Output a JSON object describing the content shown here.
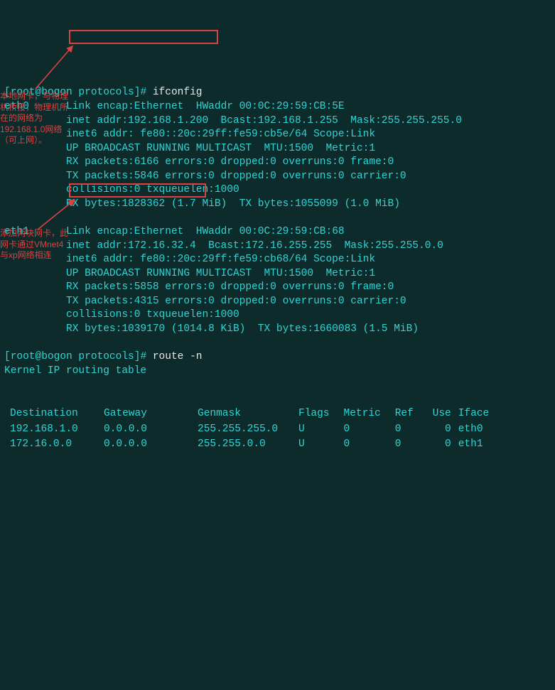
{
  "prompt1": {
    "user_host": "root@bogon",
    "dir": "protocols",
    "cmd": "ifconfig"
  },
  "prompt2": {
    "user_host": "root@bogon",
    "dir": "protocols",
    "cmd": "route -n"
  },
  "eth0": {
    "name": "eth0",
    "link": "Link encap:Ethernet  HWaddr 00:0C:29:59:CB:5E",
    "inet": "inet addr:192.168.1.200",
    "inet_rest": "  Bcast:192.168.1.255  Mask:255.255.255.0",
    "inet6": "inet6 addr: fe80::20c:29ff:fe59:cb5e/64 Scope:Link",
    "flags": "UP BROADCAST RUNNING MULTICAST  MTU:1500  Metric:1",
    "rx": "RX packets:6166 errors:0 dropped:0 overruns:0 frame:0",
    "tx": "TX packets:5846 errors:0 dropped:0 overruns:0 carrier:0",
    "coll": "collisions:0 txqueuelen:1000",
    "bytes": "RX bytes:1828362 (1.7 MiB)  TX bytes:1055099 (1.0 MiB)"
  },
  "eth1": {
    "name": "eth1",
    "link": "Link encap:Ethernet  HWaddr 00:0C:29:59:CB:68",
    "inet": "inet addr:172.16.32.4",
    "inet_rest": "  Bcast:172.16.255.255  Mask:255.255.0.0",
    "inet6": "inet6 addr: fe80::20c:29ff:fe59:cb68/64 Scope:Link",
    "flags": "UP BROADCAST RUNNING MULTICAST  MTU:1500  Metric:1",
    "rx": "RX packets:5858 errors:0 dropped:0 overruns:0 frame:0",
    "tx": "TX packets:4315 errors:0 dropped:0 overruns:0 carrier:0",
    "coll": "collisions:0 txqueuelen:1000",
    "bytes": "RX bytes:1039170 (1014.8 KiB)  TX bytes:1660083 (1.5 MiB)"
  },
  "note0": "本地网卡，与物理机桥接，物理机所在的网络为192.168.1.0网络（可上网）。",
  "note1": "添加两块网卡，此网卡通过VMnet4与xp网络相连",
  "route_title": "Kernel IP routing table",
  "route_hdr": {
    "c0": "Destination",
    "c1": "Gateway",
    "c2": "Genmask",
    "c3": "Flags",
    "c4": "Metric",
    "c5": "Ref",
    "c6": "Use",
    "c7": "Iface"
  },
  "route_rows": [
    {
      "c0": "192.168.1.0",
      "c1": "0.0.0.0",
      "c2": "255.255.255.0",
      "c3": "U",
      "c4": "0",
      "c5": "0",
      "c6": "0",
      "c7": "eth0"
    },
    {
      "c0": "172.16.0.0",
      "c1": "0.0.0.0",
      "c2": "255.255.0.0",
      "c3": "U",
      "c4": "0",
      "c5": "0",
      "c6": "0",
      "c7": "eth1"
    }
  ]
}
